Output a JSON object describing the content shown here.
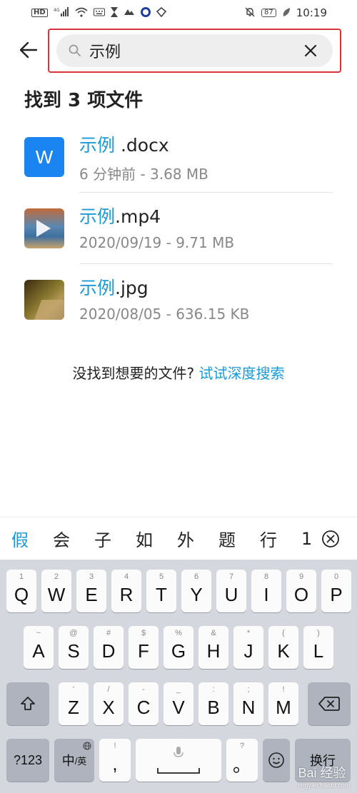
{
  "status_bar": {
    "hd_label": "HD",
    "network_label": "4G",
    "battery_level": "87",
    "time": "10:19"
  },
  "search": {
    "query": "示例"
  },
  "results": {
    "count_text": "找到 3 项文件",
    "files": [
      {
        "highlight": "示例",
        "rest": " .docx",
        "meta": "6 分钟前 - 3.68 MB",
        "thumb_letter": "W",
        "type": "word"
      },
      {
        "highlight": "示例",
        "rest": ".mp4",
        "meta": "2020/09/19 - 9.71 MB",
        "type": "video"
      },
      {
        "highlight": "示例",
        "rest": ".jpg",
        "meta": "2020/08/05 - 636.15 KB",
        "type": "image"
      }
    ]
  },
  "not_found": {
    "prompt": "没找到想要的文件? ",
    "link": "试试深度搜索"
  },
  "candidates": [
    "假",
    "会",
    "子",
    "如",
    "外",
    "题",
    "行",
    "1"
  ],
  "keyboard": {
    "row1": [
      {
        "main": "Q",
        "hint": "1"
      },
      {
        "main": "W",
        "hint": "2"
      },
      {
        "main": "E",
        "hint": "3"
      },
      {
        "main": "R",
        "hint": "4"
      },
      {
        "main": "T",
        "hint": "5"
      },
      {
        "main": "Y",
        "hint": "6"
      },
      {
        "main": "U",
        "hint": "7"
      },
      {
        "main": "I",
        "hint": "8"
      },
      {
        "main": "O",
        "hint": "9"
      },
      {
        "main": "P",
        "hint": "0"
      }
    ],
    "row2": [
      {
        "main": "A",
        "hint": "~"
      },
      {
        "main": "S",
        "hint": "@"
      },
      {
        "main": "D",
        "hint": "#"
      },
      {
        "main": "F",
        "hint": "$"
      },
      {
        "main": "G",
        "hint": "%"
      },
      {
        "main": "H",
        "hint": "&"
      },
      {
        "main": "J",
        "hint": "*"
      },
      {
        "main": "K",
        "hint": "("
      },
      {
        "main": "L",
        "hint": ")"
      }
    ],
    "row3": [
      {
        "main": "Z",
        "hint": "'"
      },
      {
        "main": "X",
        "hint": "/"
      },
      {
        "main": "C",
        "hint": "-"
      },
      {
        "main": "V",
        "hint": "_"
      },
      {
        "main": "B",
        "hint": ":"
      },
      {
        "main": "N",
        "hint": ";"
      },
      {
        "main": "M",
        "hint": "!"
      }
    ],
    "numbers_label": "?123",
    "lang_main": "中",
    "lang_sub": "/英",
    "comma_main": ",",
    "comma_hint": "!",
    "period_main": "。",
    "period_hint": "?",
    "enter_label": "换行"
  },
  "watermark": {
    "text": "Bai 经验",
    "sub": "jingyan.baidu.com"
  }
}
